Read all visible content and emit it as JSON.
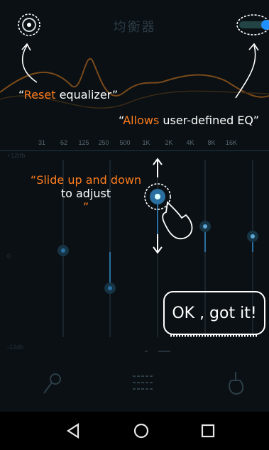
{
  "header": {
    "title": "均衡器"
  },
  "hints": {
    "reset_accent": "Reset",
    "reset_rest": " equalizer",
    "custom_accent": "Allows",
    "custom_rest": " user-defined EQ",
    "slide_line1": "Slide up and down",
    "slide_line2": "to adjust"
  },
  "frequencies": [
    "31",
    "62",
    "125",
    "250",
    "500",
    "1K",
    "2K",
    "4K",
    "8K",
    "16K"
  ],
  "db_labels": {
    "top": "+12db",
    "mid": "0",
    "bottom": "-12db"
  },
  "ok_button": {
    "label": "OK , got it!"
  },
  "colors": {
    "accent": "#ff7d1e",
    "curve": "#7a4a1a",
    "slider_active": "#2a6fa0",
    "toggle": "#1e90ff"
  },
  "icons": {
    "reset": "reset-icon",
    "toggle": "toggle-switch-icon",
    "mic": "microphone-icon",
    "list": "list-icon",
    "guitar": "guitar-icon",
    "back": "nav-back-icon",
    "home": "nav-home-icon",
    "recents": "nav-recents-icon"
  }
}
